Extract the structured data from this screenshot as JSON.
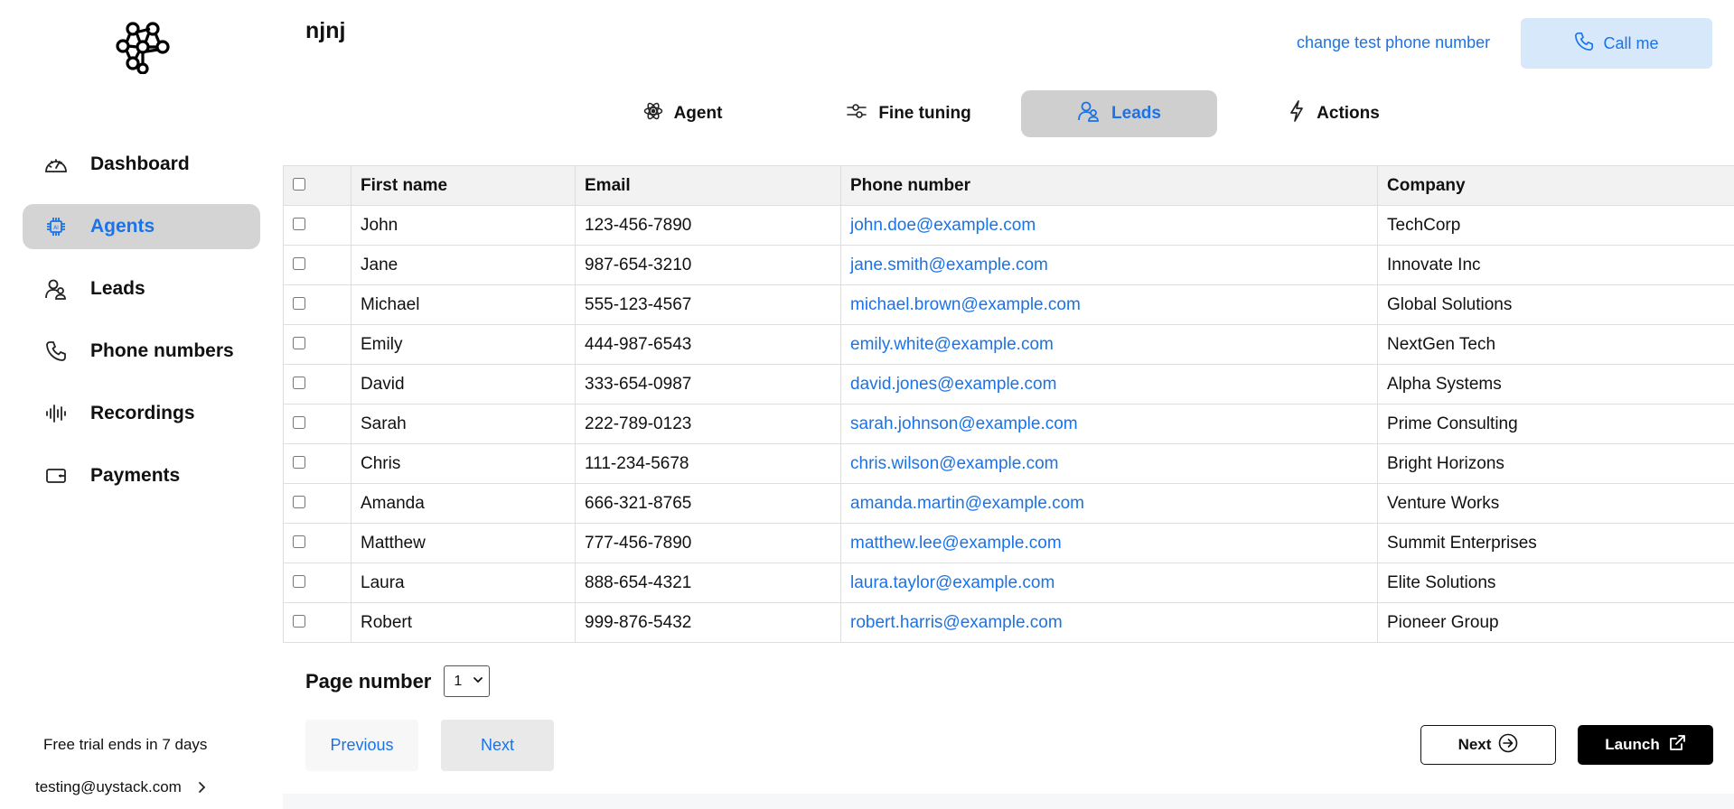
{
  "sidebar": {
    "items": [
      {
        "label": "Dashboard",
        "icon": "gauge-icon",
        "active": false
      },
      {
        "label": "Agents",
        "icon": "chip-icon",
        "active": true
      },
      {
        "label": "Leads",
        "icon": "users-icon",
        "active": false
      },
      {
        "label": "Phone numbers",
        "icon": "phone-icon",
        "active": false
      },
      {
        "label": "Recordings",
        "icon": "audio-wave-icon",
        "active": false
      },
      {
        "label": "Payments",
        "icon": "wallet-icon",
        "active": false
      }
    ],
    "trial_text": "Free trial ends in 7 days",
    "account_email": "testing@uystack.com"
  },
  "header": {
    "title": "njnj",
    "change_phone_label": "change test phone number",
    "call_label": "Call me"
  },
  "tabs": [
    {
      "label": "Agent",
      "icon": "atom-icon",
      "active": false
    },
    {
      "label": "Fine tuning",
      "icon": "sliders-icon",
      "active": false
    },
    {
      "label": "Leads",
      "icon": "users-icon",
      "active": true
    },
    {
      "label": "Actions",
      "icon": "bolt-icon",
      "active": false
    }
  ],
  "table": {
    "headers": [
      "First name",
      "Email",
      "Phone number",
      "Company"
    ],
    "rows": [
      [
        "John",
        "123-456-7890",
        "john.doe@example.com",
        "TechCorp"
      ],
      [
        "Jane",
        "987-654-3210",
        "jane.smith@example.com",
        "Innovate Inc"
      ],
      [
        "Michael",
        "555-123-4567",
        "michael.brown@example.com",
        "Global Solutions"
      ],
      [
        "Emily",
        "444-987-6543",
        "emily.white@example.com",
        "NextGen Tech"
      ],
      [
        "David",
        "333-654-0987",
        "david.jones@example.com",
        "Alpha Systems"
      ],
      [
        "Sarah",
        "222-789-0123",
        "sarah.johnson@example.com",
        "Prime Consulting"
      ],
      [
        "Chris",
        "111-234-5678",
        "chris.wilson@example.com",
        "Bright Horizons"
      ],
      [
        "Amanda",
        "666-321-8765",
        "amanda.martin@example.com",
        "Venture Works"
      ],
      [
        "Matthew",
        "777-456-7890",
        "matthew.lee@example.com",
        "Summit Enterprises"
      ],
      [
        "Laura",
        "888-654-4321",
        "laura.taylor@example.com",
        "Elite Solutions"
      ],
      [
        "Robert",
        "999-876-5432",
        "robert.harris@example.com",
        "Pioneer Group"
      ]
    ]
  },
  "pagination": {
    "page_label": "Page number",
    "selected_page": "1",
    "previous_label": "Previous",
    "next_label": "Next"
  },
  "footer_actions": {
    "next_label": "Next",
    "launch_label": "Launch"
  },
  "colors": {
    "accent": "#1a73e8",
    "active_bg": "#d4d4d4",
    "call_bg": "#d8e8fb"
  }
}
